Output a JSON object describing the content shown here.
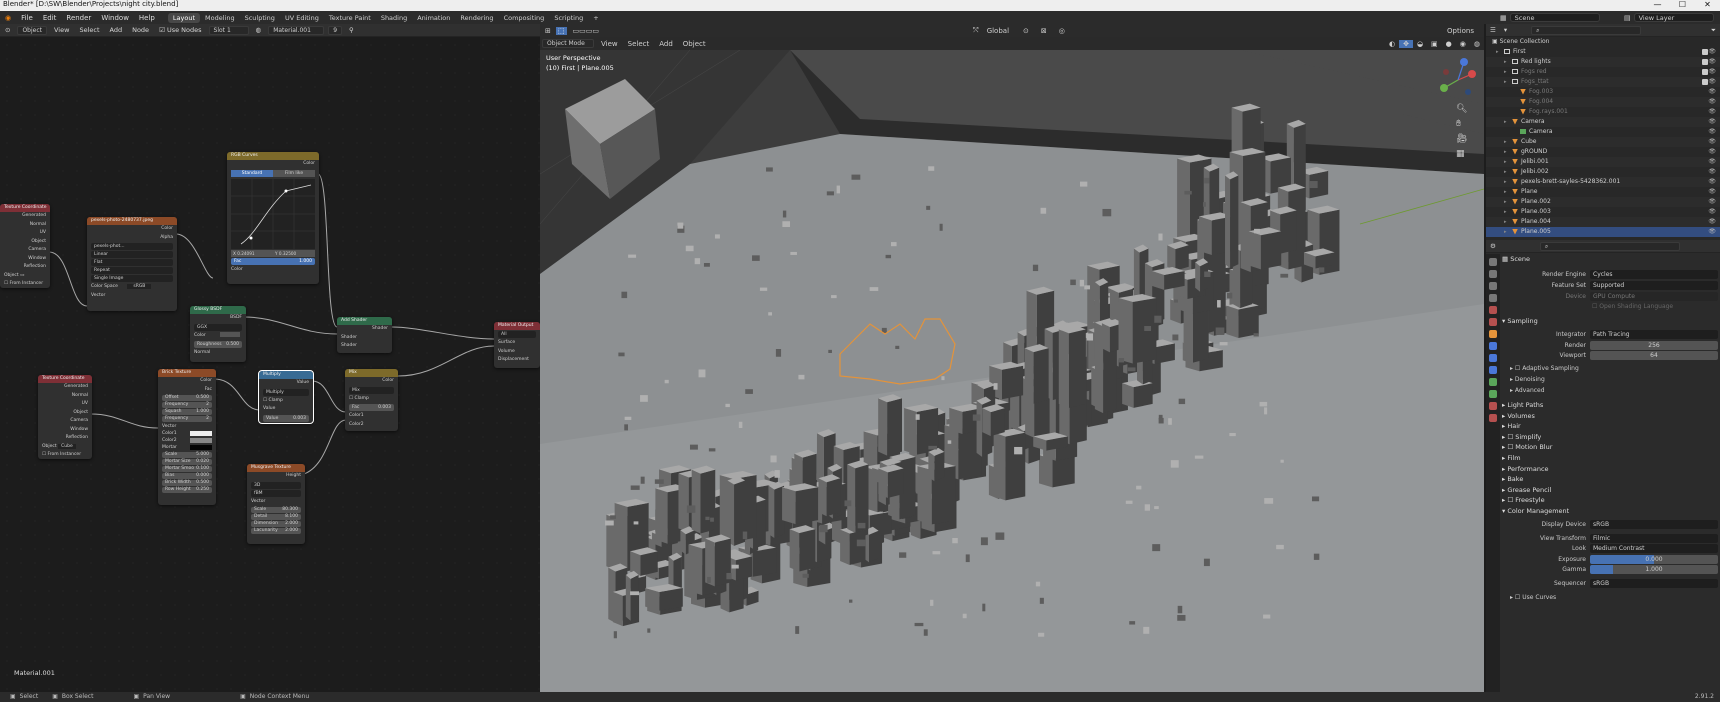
{
  "window": {
    "title": "Blender* [D:\\SW\\Blender\\Projects\\night city.blend]",
    "controls": [
      "—",
      "☐",
      "✕"
    ]
  },
  "menu": {
    "items": [
      "File",
      "Edit",
      "Render",
      "Window",
      "Help"
    ],
    "workspaces": [
      "Layout",
      "Modeling",
      "Sculpting",
      "UV Editing",
      "Texture Paint",
      "Shading",
      "Animation",
      "Rendering",
      "Compositing",
      "Scripting"
    ],
    "active_workspace": "Layout",
    "scene": "Scene",
    "view_layer": "View Layer"
  },
  "node_editor": {
    "header": {
      "object": "Object",
      "view": "View",
      "select": "Select",
      "add": "Add",
      "node": "Node",
      "use_nodes": "Use Nodes",
      "slot": "Slot 1",
      "material": "Material.001",
      "users": "9"
    },
    "footer_label": "Material.001",
    "nodes": {
      "texcoord1": {
        "title": "Texture Coordinate",
        "outs": [
          "Generated",
          "Normal",
          "UV",
          "Object",
          "Camera",
          "Window",
          "Reflection"
        ],
        "object_label": "Object",
        "from_instancer": "From Instancer"
      },
      "image": {
        "title": "pexels-photo-2480737.jpeg",
        "outs": [
          "Color",
          "Alpha"
        ],
        "file": "pexels-phot...",
        "interp": "Linear",
        "proj": "Flat",
        "ext": "Repeat",
        "src": "Single Image",
        "cs_label": "Color Space",
        "cs": "sRGB",
        "vector": "Vector"
      },
      "curves": {
        "title": "RGB Curves",
        "out": "Color",
        "tab1": "Standard",
        "tab2": "Film like",
        "x": "X 0.24091",
        "y": "Y 0.32500",
        "fac": "Fac",
        "fac_val": "1.000",
        "color": "Color"
      },
      "glossy": {
        "title": "Glossy BSDF",
        "out": "BSDF",
        "dist": "GGX",
        "color": "Color",
        "rough": "Roughness",
        "rough_val": "0.500",
        "normal": "Normal"
      },
      "add": {
        "title": "Add Shader",
        "out": "Shader",
        "in1": "Shader",
        "in2": "Shader"
      },
      "matout": {
        "title": "Material Output",
        "target": "All",
        "surface": "Surface",
        "volume": "Volume",
        "disp": "Displacement"
      },
      "texcoord2": {
        "title": "Texture Coordinate",
        "outs": [
          "Generated",
          "Normal",
          "UV",
          "Object",
          "Camera",
          "Window",
          "Reflection"
        ],
        "object_label": "Object",
        "object_val": "Cube",
        "from_instancer": "From Instancer"
      },
      "brick": {
        "title": "Brick Texture",
        "outs": [
          "Color",
          "Fac"
        ],
        "offset": [
          "Offset",
          "0.500"
        ],
        "freq1": [
          "Frequency",
          "2"
        ],
        "squash": [
          "Squash",
          "1.000"
        ],
        "freq2": [
          "Frequency",
          "2"
        ],
        "ins": [
          "Vector",
          "Color1",
          "Color2",
          "Mortar"
        ],
        "params": [
          [
            "Scale",
            "5.000"
          ],
          [
            "Mortar Size",
            "0.020"
          ],
          [
            "Mortar Smoo",
            "0.100"
          ],
          [
            "Bias",
            "0.000"
          ],
          [
            "Brick Width",
            "0.500"
          ],
          [
            "Row Height",
            "0.250"
          ]
        ]
      },
      "math": {
        "title": "Multiply",
        "out": "Value",
        "op": "Multiply",
        "clamp": "Clamp",
        "v1": "Value",
        "v2": "Value",
        "v2_val": "0.003"
      },
      "mix": {
        "title": "Mix",
        "out": "Color",
        "blend": "Mix",
        "clamp": "Clamp",
        "fac": "Fac",
        "fac_val": "0.003",
        "c1": "Color1",
        "c2": "Color2"
      },
      "musgrave": {
        "title": "Musgrave Texture",
        "out": "Height",
        "dim": "3D",
        "type": "fBM",
        "vector": "Vector",
        "params": [
          [
            "Scale",
            "80.300"
          ],
          [
            "Detail",
            "8.100"
          ],
          [
            "Dimension",
            "2.000"
          ],
          [
            "Lacunarity",
            "2.000"
          ]
        ]
      }
    }
  },
  "viewport": {
    "mode": "Object Mode",
    "menus": [
      "View",
      "Select",
      "Add",
      "Object"
    ],
    "orientation": "Global",
    "options": "Options",
    "perspective": "User Perspective",
    "context": "(10) First | Plane.005"
  },
  "outliner": {
    "title": "Scene Collection",
    "rows": [
      {
        "label": "First",
        "kind": "col",
        "depth": 1
      },
      {
        "label": "Red lights",
        "kind": "col",
        "depth": 2
      },
      {
        "label": "Fogs red",
        "kind": "col",
        "depth": 2,
        "dim": true
      },
      {
        "label": "Fogs_ttat",
        "kind": "col",
        "depth": 2,
        "dim": true
      },
      {
        "label": "Fog.003",
        "kind": "obj",
        "depth": 3,
        "dim": true
      },
      {
        "label": "Fog.004",
        "kind": "obj",
        "depth": 3,
        "dim": true
      },
      {
        "label": "Fog.rays.001",
        "kind": "obj",
        "depth": 3,
        "dim": true
      },
      {
        "label": "Camera",
        "kind": "obj",
        "depth": 2
      },
      {
        "label": "Camera",
        "kind": "cam",
        "depth": 3
      },
      {
        "label": "Cube",
        "kind": "obj",
        "depth": 2
      },
      {
        "label": "gROUND",
        "kind": "obj",
        "depth": 2
      },
      {
        "label": "Jelibi.001",
        "kind": "obj",
        "depth": 2
      },
      {
        "label": "Jelibi.002",
        "kind": "obj",
        "depth": 2
      },
      {
        "label": "pexels-brett-sayles-5428362.001",
        "kind": "obj",
        "depth": 2
      },
      {
        "label": "Plane",
        "kind": "obj",
        "depth": 2
      },
      {
        "label": "Plane.002",
        "kind": "obj",
        "depth": 2
      },
      {
        "label": "Plane.003",
        "kind": "obj",
        "depth": 2
      },
      {
        "label": "Plane.004",
        "kind": "obj",
        "depth": 2
      },
      {
        "label": "Plane.005",
        "kind": "obj",
        "depth": 2,
        "selected": true
      }
    ]
  },
  "properties": {
    "scene": "Scene",
    "render_engine": [
      "Render Engine",
      "Cycles"
    ],
    "feature_set": [
      "Feature Set",
      "Supported"
    ],
    "device": [
      "Device",
      "GPU Compute"
    ],
    "osl": "Open Shading Language",
    "sampling": "Sampling",
    "integrator": [
      "Integrator",
      "Path Tracing"
    ],
    "render": [
      "Render",
      "256"
    ],
    "viewport": [
      "Viewport",
      "64"
    ],
    "sampling_subs": [
      "Adaptive Sampling",
      "Denoising",
      "Advanced"
    ],
    "sections": [
      "Light Paths",
      "Volumes",
      "Hair",
      "Simplify",
      "Motion Blur",
      "Film",
      "Performance",
      "Bake",
      "Grease Pencil",
      "Freestyle"
    ],
    "color_management": "Color Management",
    "display_device": [
      "Display Device",
      "sRGB"
    ],
    "view_transform": [
      "View Transform",
      "Filmic"
    ],
    "look": [
      "Look",
      "Medium Contrast"
    ],
    "exposure": [
      "Exposure",
      "0.000"
    ],
    "gamma": [
      "Gamma",
      "1.000"
    ],
    "sequencer": [
      "Sequencer",
      "sRGB"
    ],
    "use_curves": "Use Curves"
  },
  "statusbar": {
    "select": "Select",
    "box_select": "Box Select",
    "pan": "Pan View",
    "context": "Node Context Menu",
    "version": "2.91.2"
  },
  "colors": {
    "selection": "#334d80",
    "object_outline": "#e4933a",
    "accent_blue": "#4772b3"
  }
}
